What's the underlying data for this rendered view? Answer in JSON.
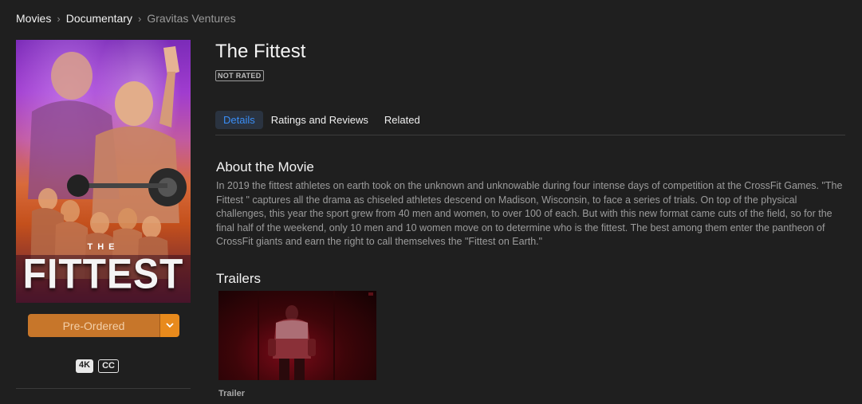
{
  "breadcrumb": {
    "items": [
      "Movies",
      "Documentary",
      "Gravitas Ventures"
    ],
    "separator": "›"
  },
  "poster": {
    "the_label": "THE",
    "title_label": "FITTEST"
  },
  "actions": {
    "preorder_label": "Pre-Ordered",
    "dropdown_icon": "chevron-down-icon",
    "accent_color": "#e88a1c"
  },
  "badges": [
    "4K",
    "CC"
  ],
  "movie": {
    "title": "The Fittest",
    "rating": "NOT RATED"
  },
  "tabs": [
    {
      "label": "Details",
      "active": true
    },
    {
      "label": "Ratings and Reviews",
      "active": false
    },
    {
      "label": "Related",
      "active": false
    }
  ],
  "about": {
    "heading": "About the Movie",
    "text": "In 2019 the fittest athletes on earth took on the unknown and unknowable during four intense days of competition at the CrossFit Games. \"The Fittest \" captures all the drama as chiseled athletes descend on Madison, Wisconsin, to face a series of trials. On top of the physical challenges, this year the sport grew from 40 men and women, to over 100 of each. But with this new format came cuts of the field, so for the final half of the weekend, only 10 men and 10 women move on to determine who is the fittest. The best among them enter the pantheon of CrossFit giants and earn the right to call themselves the \"Fittest on Earth.\""
  },
  "trailers": {
    "heading": "Trailers",
    "items": [
      {
        "label": "Trailer"
      }
    ]
  }
}
